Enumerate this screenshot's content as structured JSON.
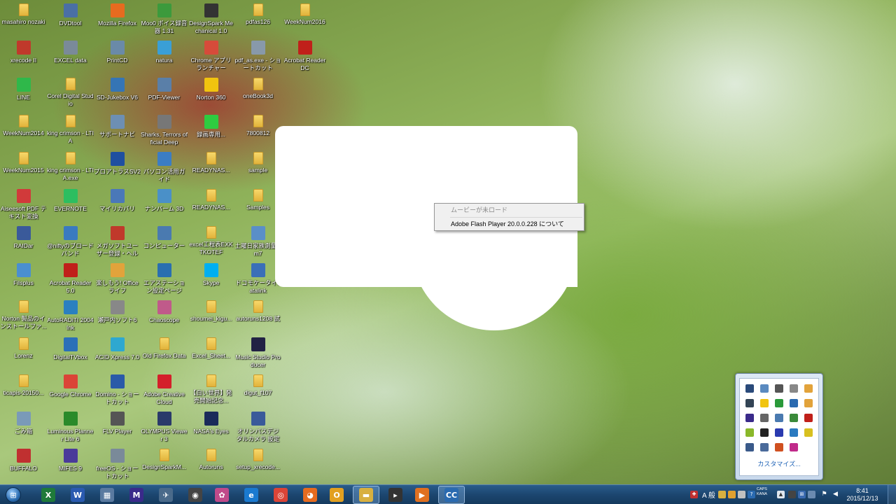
{
  "desktop_icons": [
    {
      "label": "masahiro nozaki",
      "kind": "folder",
      "color": "#e2b33b",
      "icon": "folder-icon"
    },
    {
      "label": "DVDtool",
      "kind": "app",
      "color": "#4a6fa5",
      "icon": "dvdtool-icon"
    },
    {
      "label": "Mozilla Firefox",
      "kind": "app",
      "color": "#e76b1f",
      "icon": "firefox-icon"
    },
    {
      "label": "Moo0 ボイス録音器 1.31",
      "kind": "app",
      "color": "#3c9a3c",
      "icon": "moo0-recorder-icon"
    },
    {
      "label": "DesignSpark Mechanical 1.0",
      "kind": "app",
      "color": "#333333",
      "icon": "designspark-icon"
    },
    {
      "label": "pdfas126",
      "kind": "folder",
      "color": "#e2b33b",
      "icon": "folder-icon"
    },
    {
      "label": "WeekNum2016",
      "kind": "folder",
      "color": "#e2b33b",
      "icon": "folder-icon"
    },
    {
      "label": "xrecode II",
      "kind": "app",
      "color": "#c0392b",
      "icon": "xrecode-icon"
    },
    {
      "label": "EXCEL data",
      "kind": "app",
      "color": "#7a8a99",
      "icon": "shortcut-icon"
    },
    {
      "label": "PrintCD",
      "kind": "app",
      "color": "#6a8aa8",
      "icon": "printcd-icon"
    },
    {
      "label": "natura",
      "kind": "app",
      "color": "#3a9fd6",
      "icon": "natura-icon"
    },
    {
      "label": "Chrome アプリ ランチャー",
      "kind": "app",
      "color": "#d64b3a",
      "icon": "chrome-launcher-icon"
    },
    {
      "label": "pdf_as.exe - ショートカット",
      "kind": "app",
      "color": "#8899aa",
      "icon": "shortcut-icon"
    },
    {
      "label": "Acrobat Reader DC",
      "kind": "app",
      "color": "#c0201a",
      "icon": "acrobat-icon"
    },
    {
      "label": "LINE",
      "kind": "app",
      "color": "#2fb84a",
      "icon": "line-icon"
    },
    {
      "label": "Corel Digital Studio",
      "kind": "folder",
      "color": "#e2b33b",
      "icon": "folder-icon"
    },
    {
      "label": "SD-Jukebox V6",
      "kind": "app",
      "color": "#3575b5",
      "icon": "sdjukebox-icon"
    },
    {
      "label": "PDF-Viewer",
      "kind": "app",
      "color": "#5a7fa8",
      "icon": "pdf-viewer-icon"
    },
    {
      "label": "Norton 360",
      "kind": "app",
      "color": "#f1c40f",
      "icon": "norton-icon"
    },
    {
      "label": "oneBook3d",
      "kind": "folder",
      "color": "#e2b33b",
      "icon": "folder-icon"
    },
    {
      "label": "WeekNum2014",
      "kind": "folder",
      "color": "#e2b33b",
      "icon": "folder-icon"
    },
    {
      "label": "king crimson - LTIA",
      "kind": "folder",
      "color": "#e2b33b",
      "icon": "folder-icon"
    },
    {
      "label": "サポートナビ",
      "kind": "app",
      "color": "#6d8fb3",
      "icon": "support-navi-icon"
    },
    {
      "label": "Sharks, Terrors official Deep",
      "kind": "app",
      "color": "#777777",
      "icon": "sharks-icon"
    },
    {
      "label": "録画専用...",
      "kind": "app",
      "color": "#2ecc40",
      "icon": "recorder-icon"
    },
    {
      "label": "7800812",
      "kind": "folder",
      "color": "#e2b33b",
      "icon": "folder-icon"
    },
    {
      "label": "WeekNum2015",
      "kind": "folder",
      "color": "#e2b33b",
      "icon": "folder-icon"
    },
    {
      "label": "king crimson - LTIA.exe",
      "kind": "folder",
      "color": "#e2b33b",
      "icon": "folder-icon"
    },
    {
      "label": "プロアトラスSV2",
      "kind": "app",
      "color": "#1f4fa0",
      "icon": "proatlas-icon"
    },
    {
      "label": "パソコン活用ガイド",
      "kind": "app",
      "color": "#3b7dc4",
      "icon": "guide-icon"
    },
    {
      "label": "READYNAS...",
      "kind": "folder",
      "color": "#e2b33b",
      "icon": "folder-icon"
    },
    {
      "label": "sample",
      "kind": "folder",
      "color": "#e2b33b",
      "icon": "folder-icon"
    },
    {
      "label": "Aiseesoft PDF テキスト変換",
      "kind": "app",
      "color": "#d13a3a",
      "icon": "aiseesoft-icon"
    },
    {
      "label": "EVERNOTE",
      "kind": "app",
      "color": "#2dbe60",
      "icon": "evernote-icon"
    },
    {
      "label": "マイリカバリ",
      "kind": "app",
      "color": "#4a78b8",
      "icon": "recovery-icon"
    },
    {
      "label": "ナンバーム 3D",
      "kind": "app",
      "color": "#4a90c8",
      "icon": "number-3d-icon"
    },
    {
      "label": "READYNAS...",
      "kind": "folder",
      "color": "#e2b33b",
      "icon": "folder-icon"
    },
    {
      "label": "Samples",
      "kind": "folder",
      "color": "#e2b33b",
      "icon": "folder-icon"
    },
    {
      "label": "RAIDar",
      "kind": "app",
      "color": "#3a5a9a",
      "icon": "raidar-icon"
    },
    {
      "label": "@niftyのブロードバンド",
      "kind": "app",
      "color": "#3a7ac0",
      "icon": "nifty-icon"
    },
    {
      "label": "メガソフトユーザー登録・ヘルプ",
      "kind": "app",
      "color": "#c0392b",
      "icon": "megasoft-icon"
    },
    {
      "label": "コンピューター",
      "kind": "app",
      "color": "#4a7ab0",
      "icon": "computer-icon"
    },
    {
      "label": "excel工程表EXKTKOTEF",
      "kind": "folder",
      "color": "#e2b33b",
      "icon": "folder-icon"
    },
    {
      "label": "土曜日家族測量.km7",
      "kind": "app",
      "color": "#5a8fc8",
      "icon": "file-icon"
    },
    {
      "label": "Filsplus",
      "kind": "app",
      "color": "#4a8fd0",
      "icon": "filsplus-icon"
    },
    {
      "label": "Acrobat Reader 5.0",
      "kind": "app",
      "color": "#c0201a",
      "icon": "acrobat-icon"
    },
    {
      "label": "楽しもう! Office ライフ",
      "kind": "app",
      "color": "#e2a33b",
      "icon": "office-life-icon"
    },
    {
      "label": "エアステーション設定ページ",
      "kind": "app",
      "color": "#2a6fb0",
      "icon": "airstation-icon"
    },
    {
      "label": "Skype",
      "kind": "app",
      "color": "#00aff0",
      "icon": "skype-icon"
    },
    {
      "label": "ドコモケータイdatalink",
      "kind": "app",
      "color": "#3a6fb8",
      "icon": "docomo-icon"
    },
    {
      "label": "Norton 製品のインストールファ...",
      "kind": "folder",
      "color": "#e2b33b",
      "icon": "folder-icon"
    },
    {
      "label": "AutoRADiTI 2004 Ink",
      "kind": "app",
      "color": "#2a80c0",
      "icon": "autoradit-icon"
    },
    {
      "label": "瀬戸内ソフト6",
      "kind": "app",
      "color": "#888888",
      "icon": "software-icon"
    },
    {
      "label": "Chaoscope",
      "kind": "app",
      "color": "#c05a8a",
      "icon": "chaoscope-icon"
    },
    {
      "label": "shoumei_kigu...",
      "kind": "folder",
      "color": "#e2b33b",
      "icon": "folder-icon"
    },
    {
      "label": "autoruns1208 試",
      "kind": "folder",
      "color": "#e2b33b",
      "icon": "folder-icon"
    },
    {
      "label": "Lorenz",
      "kind": "folder",
      "color": "#e2b33b",
      "icon": "folder-icon"
    },
    {
      "label": "DigitalTVbox",
      "kind": "app",
      "color": "#2a70b8",
      "icon": "digitaltv-icon"
    },
    {
      "label": "ACID Xpress 7.0",
      "kind": "app",
      "color": "#2ea8d0",
      "icon": "acid-icon"
    },
    {
      "label": "Old Firefox Data",
      "kind": "folder",
      "color": "#e2b33b",
      "icon": "folder-icon"
    },
    {
      "label": "Excel_Sheet...",
      "kind": "folder",
      "color": "#e2b33b",
      "icon": "folder-icon"
    },
    {
      "label": "Music Studio Producer",
      "kind": "app",
      "color": "#222244",
      "icon": "music-studio-icon"
    },
    {
      "label": "ticapis-20150...",
      "kind": "folder",
      "color": "#e2b33b",
      "icon": "folder-icon"
    },
    {
      "label": "Google Chrome",
      "kind": "app",
      "color": "#db4437",
      "icon": "chrome-icon"
    },
    {
      "label": "Domino - ショートカット",
      "kind": "app",
      "color": "#2a5aa8",
      "icon": "domino-icon"
    },
    {
      "label": "Adobe Creative Cloud",
      "kind": "app",
      "color": "#d4202a",
      "icon": "creative-cloud-icon"
    },
    {
      "label": "【白い世界】発売開始記念...",
      "kind": "folder",
      "color": "#e2b33b",
      "icon": "folder-icon"
    },
    {
      "label": "digut_f107",
      "kind": "folder",
      "color": "#e2b33b",
      "icon": "folder-icon"
    },
    {
      "label": "ごみ箱",
      "kind": "app",
      "color": "#7a9ab8",
      "icon": "recycle-bin-icon"
    },
    {
      "label": "Luminous Planner Lite 6",
      "kind": "app",
      "color": "#2a8a2a",
      "icon": "luminous-icon"
    },
    {
      "label": "FLV Player",
      "kind": "app",
      "color": "#555555",
      "icon": "flv-player-icon"
    },
    {
      "label": "OLYMPUS Viewer 3",
      "kind": "app",
      "color": "#2a3a6a",
      "icon": "olympus-icon"
    },
    {
      "label": "NASA's Eyes",
      "kind": "app",
      "color": "#1a2a5a",
      "icon": "nasa-eyes-icon"
    },
    {
      "label": "オリンパスデジタルカメラ 設定",
      "kind": "app",
      "color": "#3a5a9a",
      "icon": "olympus-settings-icon"
    },
    {
      "label": "BUFFALO",
      "kind": "app",
      "color": "#c03030",
      "icon": "buffalo-icon"
    },
    {
      "label": "MIFES 9",
      "kind": "app",
      "color": "#4a3a9a",
      "icon": "mifes-icon"
    },
    {
      "label": "freeOS - ショートカット",
      "kind": "app",
      "color": "#7a8a99",
      "icon": "shortcut-icon"
    },
    {
      "label": "DesignSparkM...",
      "kind": "folder",
      "color": "#e2b33b",
      "icon": "folder-icon"
    },
    {
      "label": "Autoruns",
      "kind": "folder",
      "color": "#e2b33b",
      "icon": "folder-icon"
    },
    {
      "label": "setup_xrecode...",
      "kind": "folder",
      "color": "#e2b33b",
      "icon": "folder-icon"
    }
  ],
  "context_menu": {
    "item_disabled": "ムービーが未ロード",
    "item_about": "Adobe Flash Player 20.0.0.228 について"
  },
  "tray_popup": {
    "customize_label": "カスタマイズ...",
    "icons": [
      {
        "name": "monitor-icon",
        "color": "#2a4a7a"
      },
      {
        "name": "disc-icon",
        "color": "#5a8ac0"
      },
      {
        "name": "battery-icon",
        "color": "#555555"
      },
      {
        "name": "printer-icon",
        "color": "#888888"
      },
      {
        "name": "note-icon",
        "color": "#e2a33b"
      },
      {
        "name": "display-icon",
        "color": "#334455"
      },
      {
        "name": "norton-tray-icon",
        "color": "#f1c40f"
      },
      {
        "name": "signal-icon",
        "color": "#2a9a3a"
      },
      {
        "name": "network-tray-icon",
        "color": "#2a6ab0"
      },
      {
        "name": "gear-icon",
        "color": "#e2a33b"
      },
      {
        "name": "mifes-tray-icon",
        "color": "#3a2a8a"
      },
      {
        "name": "camera-icon",
        "color": "#666666"
      },
      {
        "name": "usb-icon",
        "color": "#4a7ab0"
      },
      {
        "name": "sync-icon",
        "color": "#3a8a3a"
      },
      {
        "name": "acrobat-tray-icon",
        "color": "#c0201a"
      },
      {
        "name": "security-icon",
        "color": "#8ab82a"
      },
      {
        "name": "speaker-tray-icon",
        "color": "#222222"
      },
      {
        "name": "tv-icon",
        "color": "#2a3ab0"
      },
      {
        "name": "bluetooth-icon",
        "color": "#2a7ac0"
      },
      {
        "name": "smiley-icon",
        "color": "#d8c020"
      },
      {
        "name": "device-icon",
        "color": "#3a5a8a"
      },
      {
        "name": "lan-icon",
        "color": "#4a6a9a"
      },
      {
        "name": "volume-icon",
        "color": "#d05020"
      },
      {
        "name": "pinwheel-icon",
        "color": "#c02a8a"
      }
    ]
  },
  "taskbar": {
    "apps": [
      {
        "name": "excel-taskbar-icon",
        "glyph": "X",
        "color": "#1f7a3a",
        "active": false
      },
      {
        "name": "word-taskbar-icon",
        "glyph": "W",
        "color": "#2a5ab0",
        "active": false
      },
      {
        "name": "window-manager-taskbar-icon",
        "glyph": "▦",
        "color": "#5a7aa0",
        "active": false
      },
      {
        "name": "mifes-taskbar-icon",
        "glyph": "M",
        "color": "#3a2a8a",
        "active": false
      },
      {
        "name": "eagle-taskbar-icon",
        "glyph": "✈",
        "color": "#4a6a8a",
        "active": false
      },
      {
        "name": "camera-taskbar-icon",
        "glyph": "◉",
        "color": "#444444",
        "active": false
      },
      {
        "name": "picasa-taskbar-icon",
        "glyph": "✿",
        "color": "#c04a8a",
        "active": false
      },
      {
        "name": "ie-taskbar-icon",
        "glyph": "e",
        "color": "#1a7ad0",
        "active": false
      },
      {
        "name": "chrome-taskbar-icon",
        "glyph": "◎",
        "color": "#db4437",
        "active": false
      },
      {
        "name": "firefox-taskbar-icon",
        "glyph": "◕",
        "color": "#e76b1f",
        "active": false
      },
      {
        "name": "outlook-taskbar-icon",
        "glyph": "O",
        "color": "#e2a020",
        "active": false
      },
      {
        "name": "explorer-taskbar-icon",
        "glyph": "▬",
        "color": "#d8b040",
        "active": true
      },
      {
        "name": "gun-taskbar-icon",
        "glyph": "▸",
        "color": "#333333",
        "active": false
      },
      {
        "name": "media-player-taskbar-icon",
        "glyph": "▶",
        "color": "#e07020",
        "active": false
      },
      {
        "name": "cc-taskbar-icon",
        "glyph": "CC",
        "color": "#2a6ab0",
        "active": true
      }
    ],
    "ime_label": "A 般",
    "caps_label": "CAPS\nKANA",
    "clock_time": "8:41",
    "clock_date": "2015/12/13"
  }
}
